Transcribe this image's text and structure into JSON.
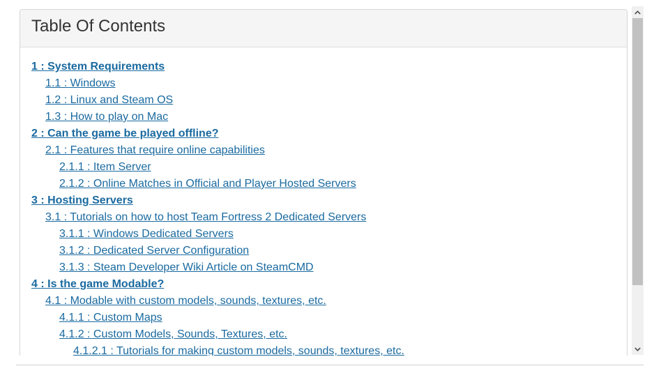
{
  "toc": {
    "title": "Table Of Contents",
    "items": [
      {
        "label": "1 : System Requirements",
        "level": 1
      },
      {
        "label": "1.1 : Windows",
        "level": 2
      },
      {
        "label": "1.2 : Linux and Steam OS",
        "level": 2
      },
      {
        "label": "1.3 : How to play on Mac",
        "level": 2
      },
      {
        "label": "2 : Can the game be played offline?",
        "level": 1
      },
      {
        "label": "2.1 : Features that require online capabilities",
        "level": 2
      },
      {
        "label": "2.1.1 : Item Server",
        "level": 3
      },
      {
        "label": "2.1.2 : Online Matches in Official and Player Hosted Servers",
        "level": 3
      },
      {
        "label": "3 : Hosting Servers",
        "level": 1
      },
      {
        "label": "3.1 : Tutorials on how to host Team Fortress 2 Dedicated Servers",
        "level": 2
      },
      {
        "label": "3.1.1 : Windows Dedicated Servers",
        "level": 3
      },
      {
        "label": "3.1.2 : Dedicated Server Configuration",
        "level": 3
      },
      {
        "label": "3.1.3 : Steam Developer Wiki Article on SteamCMD",
        "level": 3
      },
      {
        "label": "4 : Is the game Modable?",
        "level": 1
      },
      {
        "label": "4.1 : Modable with custom models, sounds, textures, etc.",
        "level": 2
      },
      {
        "label": "4.1.1 : Custom Maps",
        "level": 3
      },
      {
        "label": "4.1.2 : Custom Models, Sounds, Textures, etc.",
        "level": 3
      },
      {
        "label": "4.1.2.1 : Tutorials for making custom models, sounds, textures, etc.",
        "level": 4
      }
    ]
  },
  "scrollbar": {
    "up_icon": "chevron-up-icon",
    "down_icon": "chevron-down-icon",
    "position_fraction": 0.0
  },
  "colors": {
    "link": "#1a6aa0",
    "heading_bg": "#f5f5f5",
    "border": "#d6d6d6"
  }
}
